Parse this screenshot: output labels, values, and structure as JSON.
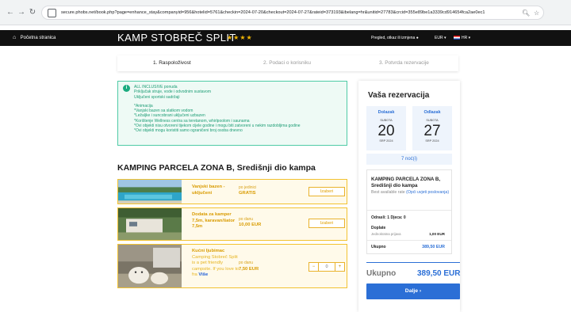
{
  "browser": {
    "url": "secure.phobs.net/book.php?page=enhance_stay&companyid=956&hotelid=5761&checkin=2024-07-20&checkout=2024-07-27&rateid=373193&ibelang=hr&unitid=27783&crcid=355e89be1a3339cd914654fca2ae0ec1"
  },
  "header": {
    "home_label": "Početna stranica",
    "camp_name": "KAMP STOBREČ SPLIT",
    "stars": "★★★★",
    "manage_label": "Pregled, otkaz ili izmjena",
    "currency": "EUR ▾",
    "language": "HR ▾"
  },
  "steps": [
    {
      "label": "1.   Raspoloživost"
    },
    {
      "label": "2.   Podaci o korisniku"
    },
    {
      "label": "3.   Potvrda rezervacije"
    }
  ],
  "info": {
    "lines_a": [
      "ALL INCLUSIVE ponuda",
      "Priključak struje, vode i odvodnim sustavom",
      "Uključeni sportski sadržaji"
    ],
    "lines_b": [
      "*Animacija",
      "*Vanjski bazen sa slatkom vodom",
      "*Ležaljke i suncobrani uključeni uzbazen",
      "*Korištenje Wellness centra sa teretanom, whirlpoolom i saunama",
      "*Ovi objekti nisu otvoreni tijekom cijele godine i mogu biti zatvoreni u nekim razdobljima godine",
      "*Ovi objekti mogu koristiti samo ograničeni broj osoba dnevno"
    ]
  },
  "section_title": "KAMPING PARCELA ZONA B, Središnji dio kampa",
  "items": [
    {
      "name_1": "Vanjski bazen -",
      "name_2": "uključeni",
      "price_label": "po jedinici",
      "price": "GRATIS",
      "button": "Izaberi"
    },
    {
      "name_1": "Dodata za kamper",
      "name_2": "7,5m, karavan/šator",
      "name_3": "7,5m",
      "price_label": "po danu",
      "price": "10,00 EUR",
      "button": "Izaberi"
    },
    {
      "name_1": "Kućni ljubimac",
      "desc_1": "Camping Stobreč Split",
      "desc_2": "is a pet friendly",
      "desc_3": "campsite. If you love to",
      "desc_4": "fra",
      "more": "Više",
      "price_label": "po danu",
      "price": "7,50 EUR",
      "minus": "−",
      "qty": "0",
      "plus": "+"
    }
  ],
  "reservation": {
    "title": "Vaša rezervacija",
    "checkin": {
      "label": "Dolazak",
      "dow": "SUBOTA",
      "day": "20",
      "month": "SRP 2024"
    },
    "checkout": {
      "label": "Odlazak",
      "dow": "SUBOTA",
      "day": "27",
      "month": "SRP 2024"
    },
    "nights": "7 noć(i)",
    "unit_name": "KAMPING PARCELA ZONA B, Središnji dio kampa",
    "rate_prefix": "Best available rate ",
    "rate_link": "(Opći uvjeti poslovanja)",
    "guests": "Odrasli: 1    Djeca: 0",
    "extras_label": "Doplate",
    "extra_item": "Jednokratna prijava",
    "extra_price": "1,00 EUR",
    "subtotal_label": "Ukupno",
    "subtotal": "389,50 EUR",
    "total_label": "Ukupno",
    "total": "389,50 EUR",
    "next_button": "Dalje  ›"
  },
  "colors": {
    "accent_blue": "#2b6fd6",
    "info_green": "#1aab7f",
    "item_gold": "#f2c230",
    "header_bg": "#111111"
  }
}
